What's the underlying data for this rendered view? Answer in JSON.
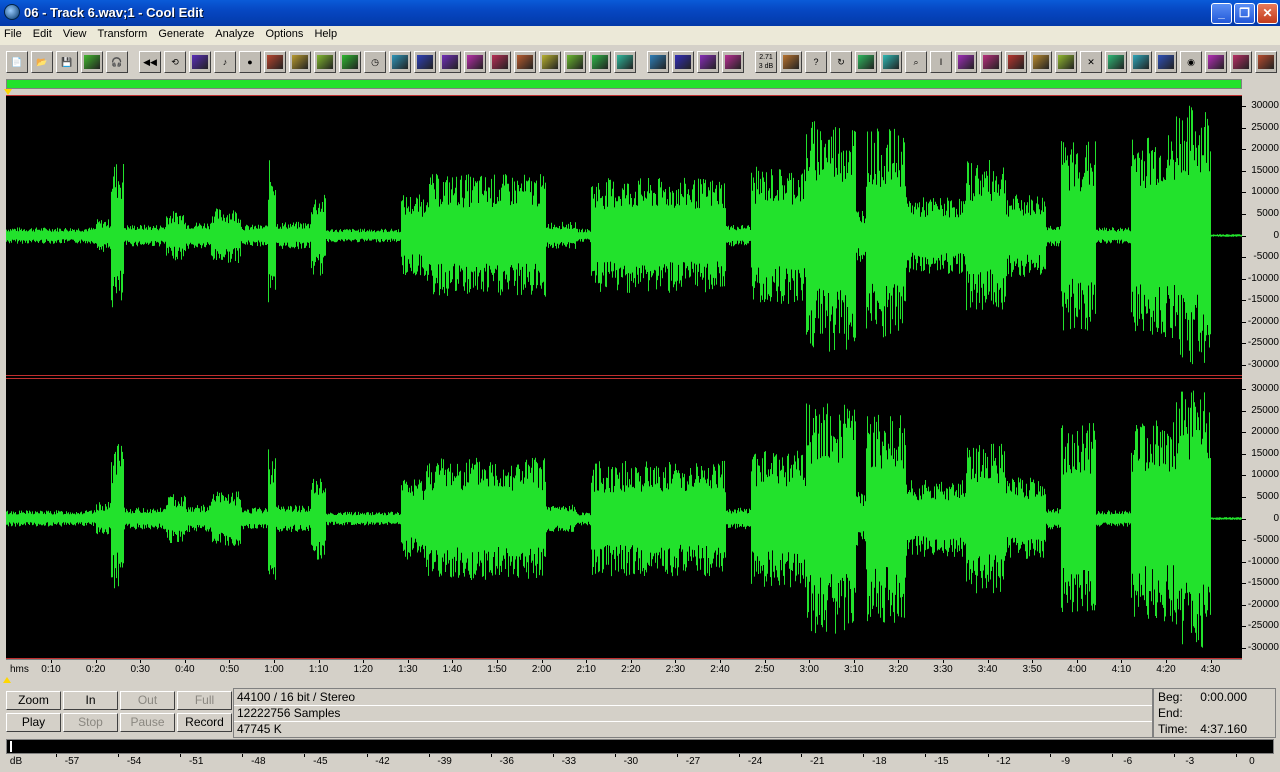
{
  "window": {
    "title": "06 - Track  6.wav;1 - Cool Edit",
    "minimize": "_",
    "maximize": "❐",
    "close": "✕"
  },
  "menu": [
    "File",
    "Edit",
    "View",
    "Transform",
    "Generate",
    "Analyze",
    "Options",
    "Help"
  ],
  "toolbar": {
    "buttons": [
      "new",
      "open",
      "save",
      "save-selection",
      "headphones",
      "rewind",
      "loop",
      "swap-channels",
      "note",
      "circle",
      "wave-insert",
      "fade",
      "envelope",
      "filter",
      "clock",
      "record-loop",
      "tape",
      "noise",
      "brightness",
      "spectrum",
      "eq",
      "delay",
      "wave",
      "pencil",
      "shrink",
      "cue-1",
      "cue-2",
      "cue-3",
      "cue-4",
      "gain",
      "zoom-globe",
      "help",
      "refresh",
      "cd",
      "freq",
      "search",
      "cursor",
      "notes",
      "list-1",
      "list-2",
      "wave-a",
      "wave-b",
      "cross",
      "scope-1",
      "scope-2",
      "mixer",
      "bullseye",
      "play-list",
      "grid-1",
      "grid-2"
    ],
    "gain_label": "2.71\n3 dB"
  },
  "waveform": {
    "color": "#22e22c",
    "channels": [
      "left",
      "right"
    ],
    "y_ticks": [
      "30000",
      "25000",
      "20000",
      "15000",
      "10000",
      "5000",
      "0",
      "-5000",
      "-10000",
      "-15000",
      "-20000",
      "-25000",
      "-30000"
    ],
    "time_unit": "hms",
    "time_ticks": [
      "0:10",
      "0:20",
      "0:30",
      "0:40",
      "0:50",
      "1:00",
      "1:10",
      "1:20",
      "1:30",
      "1:40",
      "1:50",
      "2:00",
      "2:10",
      "2:20",
      "2:30",
      "2:40",
      "2:50",
      "3:00",
      "3:10",
      "3:20",
      "3:30",
      "3:40",
      "3:50",
      "4:00",
      "4:10",
      "4:20",
      "4:30"
    ]
  },
  "transport": {
    "zoom": "Zoom",
    "zoom_in": "In",
    "zoom_out": "Out",
    "zoom_full": "Full",
    "play": "Play",
    "stop": "Stop",
    "pause": "Pause",
    "record": "Record"
  },
  "info": {
    "format": "44100 / 16 bit / Stereo",
    "samples": "12222756 Samples",
    "size": "47745 K"
  },
  "time_info": {
    "beg_label": "Beg:",
    "beg_value": "0:00.000",
    "end_label": "End:",
    "end_value": "",
    "time_label": "Time:",
    "time_value": "4:37.160"
  },
  "level_meter": {
    "unit": "dB",
    "ticks": [
      "-57",
      "-54",
      "-51",
      "-48",
      "-45",
      "-42",
      "-39",
      "-36",
      "-33",
      "-30",
      "-27",
      "-24",
      "-21",
      "-18",
      "-15",
      "-12",
      "-9",
      "-6",
      "-3",
      "0"
    ]
  }
}
